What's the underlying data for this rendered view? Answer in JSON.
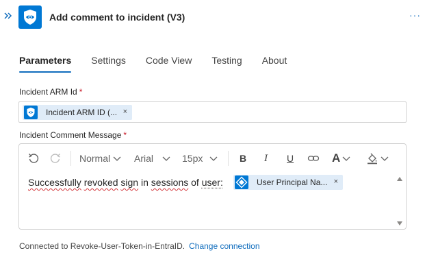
{
  "header": {
    "title": "Add comment to incident (V3)",
    "more_label": "···",
    "collapse_icon": "double-chevron-right-icon",
    "app_icon": "sentinel-shield-icon",
    "brand_color": "#0078d4"
  },
  "tabs": [
    {
      "label": "Parameters",
      "active": true
    },
    {
      "label": "Settings",
      "active": false
    },
    {
      "label": "Code View",
      "active": false
    },
    {
      "label": "Testing",
      "active": false
    },
    {
      "label": "About",
      "active": false
    }
  ],
  "fields": {
    "arm_id": {
      "label": "Incident ARM Id",
      "required_mark": "*",
      "token": {
        "text": "Incident ARM ID (...",
        "remove": "×",
        "icon": "sentinel-shield-icon"
      }
    },
    "comment": {
      "label": "Incident Comment Message",
      "required_mark": "*",
      "toolbar": {
        "undo_icon": "undo-icon",
        "redo_icon": "redo-icon",
        "format": "Normal",
        "font": "Arial",
        "size": "15px",
        "bold": "B",
        "italic": "I",
        "underline": "U",
        "link_icon": "link-icon",
        "font_color_label": "A",
        "highlight_icon": "highlight-fill-icon"
      },
      "message_words": [
        "Successfully",
        "revoked",
        "sign",
        "in",
        "sessions",
        "of",
        "user:"
      ],
      "token": {
        "text": "User Principal Na...",
        "remove": "×",
        "icon": "entra-id-icon"
      }
    }
  },
  "footer": {
    "connected_text": "Connected to Revoke-User-Token-in-EntraID.",
    "change_link": "Change connection"
  },
  "colors": {
    "accent": "#0f6cbd",
    "required": "#c50f1f",
    "token_bg": "#e0ecf8"
  }
}
